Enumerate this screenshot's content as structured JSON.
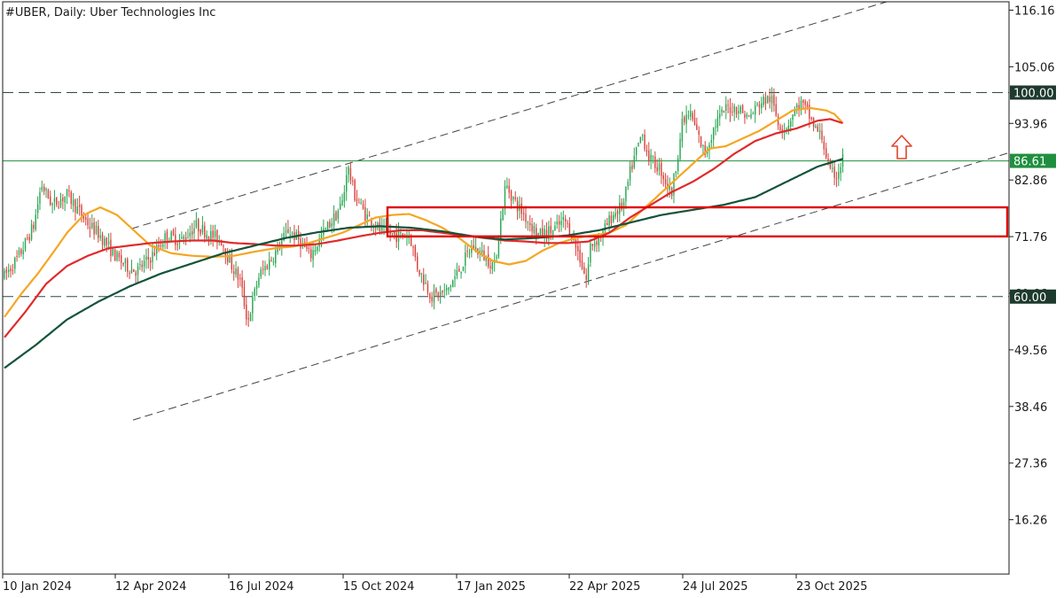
{
  "header": {
    "title": "#UBER, Daily:  Uber Technologies Inc"
  },
  "colors": {
    "bull": "#26a651",
    "bear": "#d8403a",
    "ma_fast": "#f5a623",
    "ma_mid": "#e02a2a",
    "ma_slow": "#14533a",
    "zone": "#e00000",
    "arrow": "#e0442a",
    "tag_price": "#1f8f3f",
    "tag_level": "#1e3a2e"
  },
  "chart_data": {
    "type": "candlestick",
    "symbol": "#UBER",
    "timeframe": "Daily",
    "instrument": "Uber Technologies Inc",
    "y_ticks": [
      "116.16",
      "105.06",
      "93.96",
      "82.86",
      "71.76",
      "60.66",
      "49.56",
      "38.46",
      "27.36",
      "16.26"
    ],
    "ylim": [
      5.6,
      117.8
    ],
    "x_labels": [
      "10 Jan 2024",
      "12 Apr 2024",
      "16 Jul 2024",
      "15 Oct 2024",
      "17 Jan 2025",
      "22 Apr 2025",
      "24 Jul 2025",
      "23 Oct 2025"
    ],
    "last_price": "86.61",
    "last_price_value": 86.61,
    "levels": [
      {
        "label": "100.00",
        "value": 100.0,
        "style": "dashed"
      },
      {
        "label": "60.00",
        "value": 60.0,
        "style": "dashed"
      }
    ],
    "moving_averages": [
      {
        "color_key": "ma_fast",
        "points": [
          [
            0,
            56.0
          ],
          [
            8,
            60.5
          ],
          [
            16,
            64.5
          ],
          [
            24,
            69.0
          ],
          [
            30,
            72.5
          ],
          [
            38,
            76.0
          ],
          [
            46,
            77.5
          ],
          [
            54,
            76.0
          ],
          [
            62,
            73.0
          ],
          [
            70,
            70.0
          ],
          [
            80,
            68.5
          ],
          [
            90,
            68.0
          ],
          [
            100,
            67.8
          ],
          [
            110,
            68.0
          ],
          [
            120,
            68.8
          ],
          [
            130,
            69.5
          ],
          [
            138,
            69.8
          ],
          [
            146,
            70.5
          ],
          [
            154,
            71.5
          ],
          [
            162,
            72.5
          ],
          [
            170,
            74.0
          ],
          [
            178,
            75.5
          ],
          [
            186,
            76.0
          ],
          [
            194,
            76.2
          ],
          [
            202,
            75.0
          ],
          [
            210,
            73.5
          ],
          [
            218,
            71.5
          ],
          [
            226,
            69.0
          ],
          [
            234,
            67.0
          ],
          [
            242,
            66.3
          ],
          [
            250,
            67.0
          ],
          [
            258,
            69.0
          ],
          [
            266,
            70.5
          ],
          [
            274,
            71.5
          ],
          [
            282,
            72.0
          ],
          [
            290,
            72.5
          ],
          [
            298,
            74.0
          ],
          [
            306,
            77.0
          ],
          [
            314,
            80.0
          ],
          [
            322,
            83.0
          ],
          [
            330,
            86.0
          ],
          [
            338,
            89.0
          ],
          [
            346,
            89.5
          ],
          [
            354,
            91.0
          ],
          [
            362,
            92.5
          ],
          [
            370,
            94.5
          ],
          [
            378,
            96.5
          ],
          [
            386,
            97.0
          ],
          [
            394,
            96.5
          ],
          [
            398,
            95.8
          ],
          [
            402,
            94.0
          ]
        ]
      },
      {
        "color_key": "ma_mid",
        "points": [
          [
            0,
            52.0
          ],
          [
            10,
            57.0
          ],
          [
            20,
            62.5
          ],
          [
            30,
            66.0
          ],
          [
            40,
            68.0
          ],
          [
            50,
            69.5
          ],
          [
            60,
            70.0
          ],
          [
            70,
            70.5
          ],
          [
            80,
            70.8
          ],
          [
            90,
            71.0
          ],
          [
            100,
            71.0
          ],
          [
            110,
            70.5
          ],
          [
            120,
            70.3
          ],
          [
            130,
            70.0
          ],
          [
            140,
            70.0
          ],
          [
            150,
            70.3
          ],
          [
            160,
            71.0
          ],
          [
            170,
            71.8
          ],
          [
            180,
            72.5
          ],
          [
            190,
            73.0
          ],
          [
            200,
            73.0
          ],
          [
            210,
            72.5
          ],
          [
            220,
            72.0
          ],
          [
            230,
            71.5
          ],
          [
            240,
            71.0
          ],
          [
            250,
            70.8
          ],
          [
            260,
            70.5
          ],
          [
            270,
            70.5
          ],
          [
            280,
            70.8
          ],
          [
            290,
            72.5
          ],
          [
            300,
            75.5
          ],
          [
            310,
            78.0
          ],
          [
            320,
            80.5
          ],
          [
            330,
            82.5
          ],
          [
            340,
            85.0
          ],
          [
            350,
            88.0
          ],
          [
            360,
            90.5
          ],
          [
            370,
            92.0
          ],
          [
            380,
            93.0
          ],
          [
            390,
            94.5
          ],
          [
            396,
            94.8
          ],
          [
            402,
            94.0
          ]
        ]
      },
      {
        "color_key": "ma_slow",
        "points": [
          [
            0,
            46.0
          ],
          [
            15,
            50.5
          ],
          [
            30,
            55.5
          ],
          [
            45,
            59.0
          ],
          [
            60,
            62.0
          ],
          [
            75,
            64.5
          ],
          [
            90,
            66.5
          ],
          [
            105,
            68.5
          ],
          [
            120,
            70.0
          ],
          [
            135,
            71.5
          ],
          [
            150,
            72.6
          ],
          [
            165,
            73.5
          ],
          [
            180,
            73.8
          ],
          [
            195,
            73.5
          ],
          [
            210,
            72.8
          ],
          [
            225,
            71.8
          ],
          [
            240,
            71.2
          ],
          [
            255,
            71.5
          ],
          [
            270,
            72.0
          ],
          [
            285,
            73.0
          ],
          [
            300,
            74.5
          ],
          [
            315,
            76.0
          ],
          [
            330,
            77.0
          ],
          [
            345,
            78.0
          ],
          [
            360,
            79.5
          ],
          [
            375,
            82.5
          ],
          [
            390,
            85.5
          ],
          [
            402,
            87.0
          ]
        ]
      }
    ],
    "trend_channel": [
      {
        "x1": 148,
        "y1": 73.3,
        "x2": 1000,
        "y2": 117.8
      },
      {
        "x1": 150,
        "y1": 35.8,
        "x2": 1138,
        "y2": 88.2
      }
    ],
    "zone_box": {
      "top": 77.5,
      "bottom": 71.8
    },
    "arrow_direction": "up"
  }
}
